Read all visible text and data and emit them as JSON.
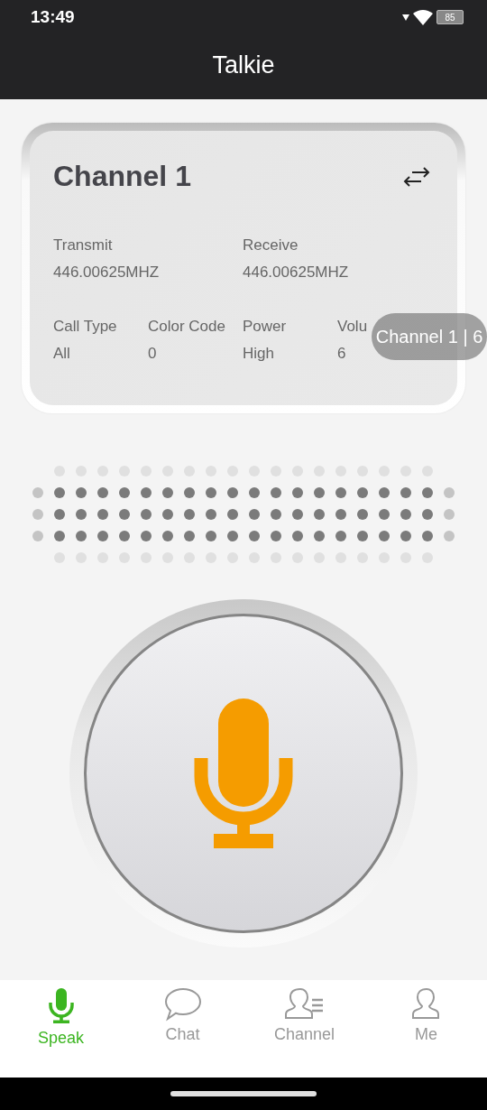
{
  "status_bar": {
    "time": "13:49",
    "battery": "85"
  },
  "header": {
    "title": "Talkie"
  },
  "channel_card": {
    "name": "Channel 1",
    "frequencies": [
      {
        "label": "Transmit",
        "value": "446.00625MHZ"
      },
      {
        "label": "Receive",
        "value": "446.00625MHZ"
      }
    ],
    "settings": [
      {
        "label": "Call Type",
        "value": "All"
      },
      {
        "label": "Color Code",
        "value": "0"
      },
      {
        "label": "Power",
        "value": "High"
      },
      {
        "label": "Volu",
        "value": "6"
      }
    ]
  },
  "toast": {
    "text": "Channel 1 | 6"
  },
  "tabs": [
    {
      "label": "Speak",
      "kind": "mic",
      "selected": true
    },
    {
      "label": "Chat",
      "kind": "chat",
      "selected": false
    },
    {
      "label": "Channel",
      "kind": "channel",
      "selected": false
    },
    {
      "label": "Me",
      "kind": "person",
      "selected": false
    }
  ]
}
